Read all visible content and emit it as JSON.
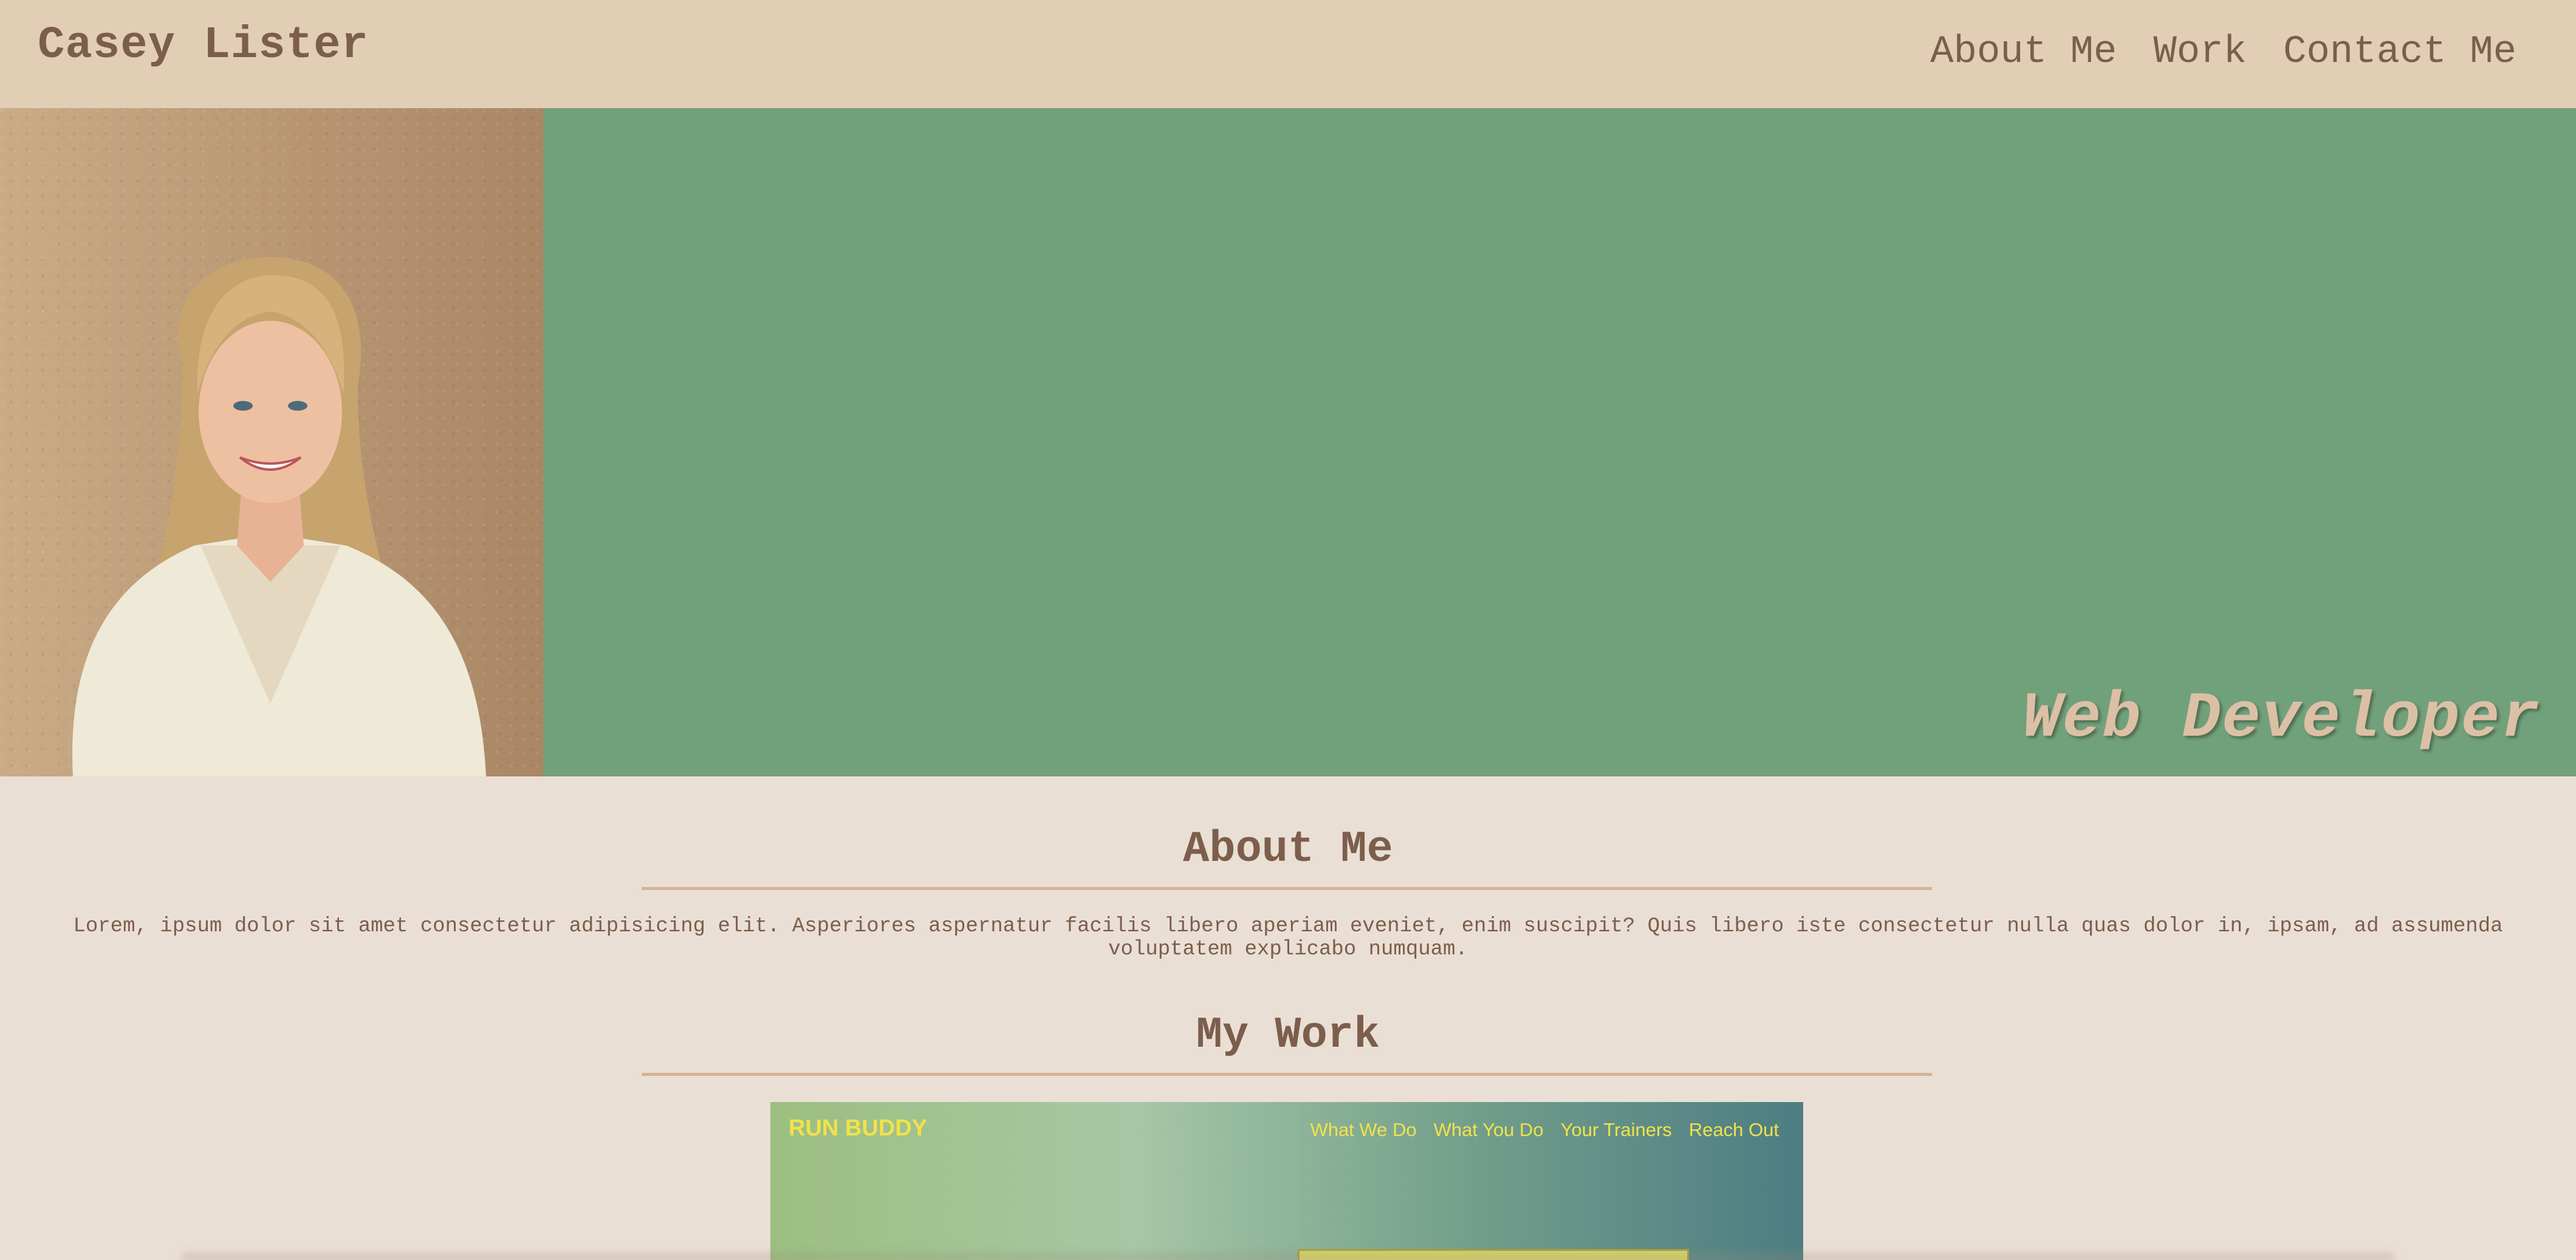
{
  "header": {
    "site_title": "Casey Lister",
    "nav": [
      {
        "label": "About Me"
      },
      {
        "label": "Work"
      },
      {
        "label": "Contact Me"
      }
    ]
  },
  "hero": {
    "tagline": "Web Developer"
  },
  "about": {
    "heading": "About Me",
    "text": "Lorem, ipsum dolor sit amet consectetur adipisicing elit. Asperiores aspernatur facilis libero aperiam eveniet, enim suscipit? Quis libero iste consectetur nulla quas dolor in, ipsam, ad assumenda voluptatem explicabo numquam."
  },
  "work": {
    "heading": "My Work",
    "project": {
      "brand": "RUN BUDDY",
      "nav": [
        "What We Do",
        "What You Do",
        "Your Trainers",
        "Reach Out"
      ]
    }
  },
  "colors": {
    "header_bg": "#e2ceb5",
    "page_bg": "#eadfd5",
    "hero_green": "#71a17b",
    "text_brown": "#7b5e4b",
    "rule": "#d5b395",
    "tagline": "#dcc0a6"
  }
}
